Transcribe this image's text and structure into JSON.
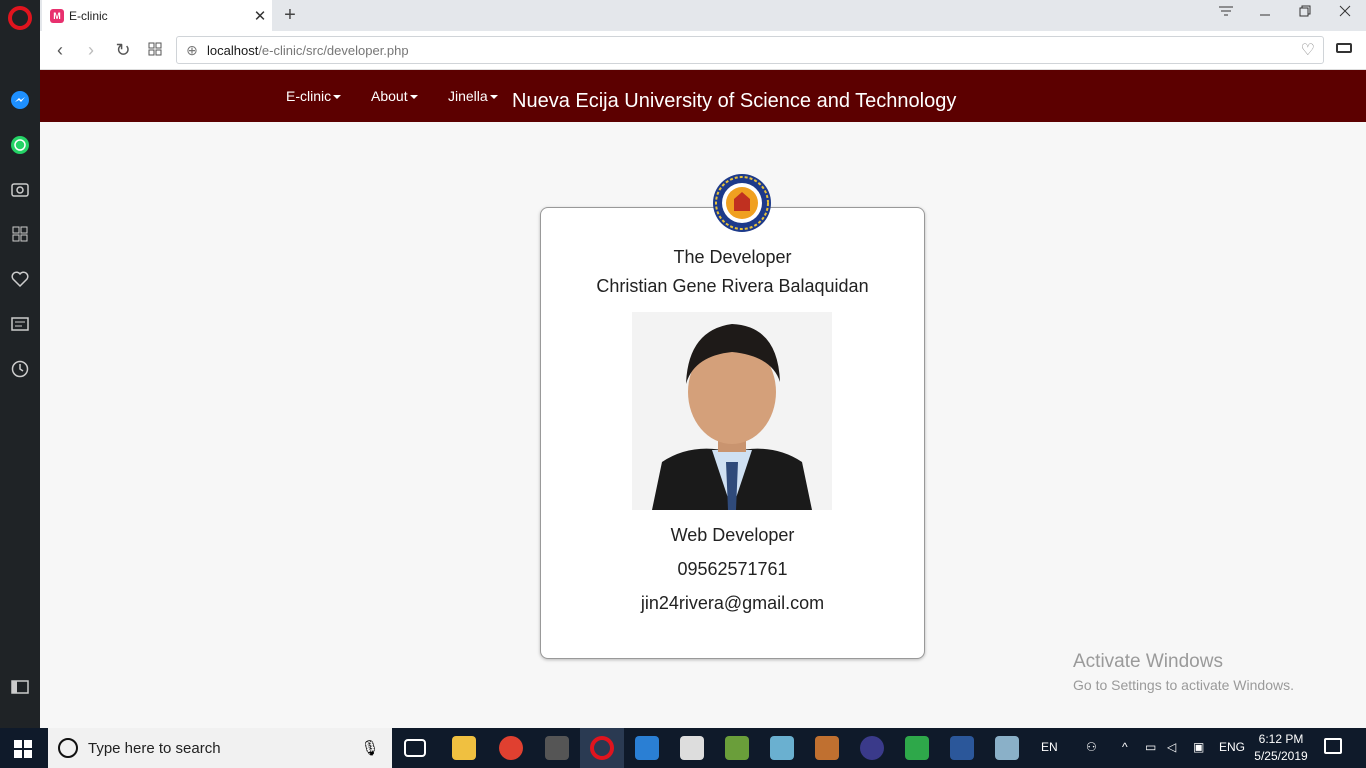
{
  "browser": {
    "tab": {
      "title": "E-clinic",
      "favicon_letter": "M"
    },
    "url": {
      "host": "localhost",
      "path": "/e-clinic/src/developer.php"
    }
  },
  "site": {
    "menu": [
      {
        "label": "E-clinic"
      },
      {
        "label": "About"
      },
      {
        "label": "Jinella"
      }
    ],
    "university": "Nueva Ecija University of Science and Technology"
  },
  "card": {
    "heading": "The Developer",
    "name": "Christian Gene Rivera Balaquidan",
    "role": "Web Developer",
    "phone": "09562571761",
    "email": "jin24rivera@gmail.com"
  },
  "watermark": {
    "line1": "Activate Windows",
    "line2": "Go to Settings to activate Windows."
  },
  "taskbar": {
    "search_placeholder": "Type here to search",
    "lang1": "EN",
    "lang2": "ENG",
    "time": "6:12 PM",
    "date": "5/25/2019"
  },
  "colors": {
    "header_bg": "#5c0000",
    "opera_red": "#e0141e"
  }
}
